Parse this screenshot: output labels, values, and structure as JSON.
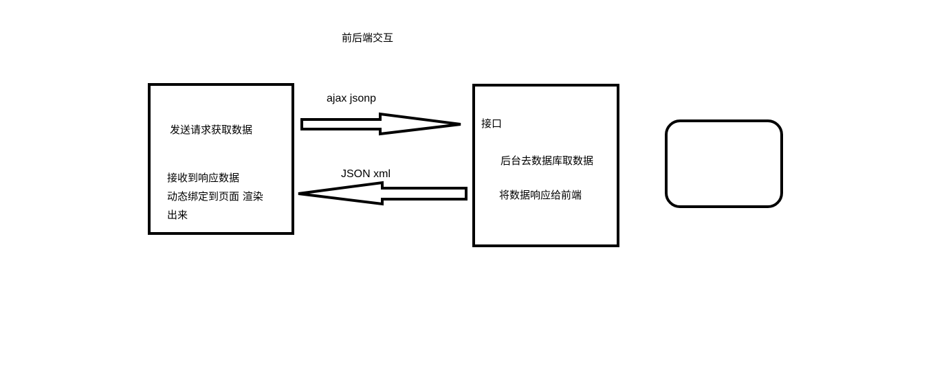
{
  "diagram": {
    "title": "前后端交互",
    "frontend_box": {
      "request_text": "发送请求获取数据",
      "response_lines": [
        "接收到响应数据",
        "动态绑定到页面 渲染",
        "出来"
      ]
    },
    "backend_box": {
      "interface_text": "接口",
      "fetch_text": "后台去数据库取数据",
      "respond_text": "将数据响应给前端"
    },
    "arrow_request": {
      "label": "ajax jsonp"
    },
    "arrow_response": {
      "label": "JSON xml"
    },
    "stroke_color": "#000000"
  }
}
